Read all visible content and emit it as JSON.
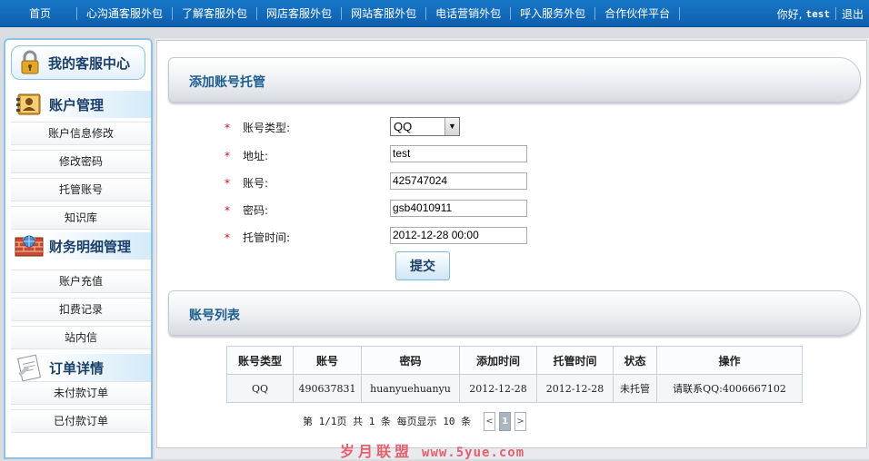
{
  "topnav": {
    "items": [
      "首页",
      "心沟通客服外包",
      "了解客服外包",
      "网店客服外包",
      "网站客服外包",
      "电话营销外包",
      "呼入服务外包",
      "合作伙伴平台"
    ],
    "greeting": "你好,",
    "username": "test",
    "logout": "退出"
  },
  "sidebar": {
    "center_title": "我的客服中心",
    "groups": [
      {
        "title": "账户管理",
        "icon": "address-book-icon",
        "items": [
          "账户信息修改",
          "修改密码",
          "托管账号",
          "知识库"
        ]
      },
      {
        "title": "财务明细管理",
        "icon": "firewall-icon",
        "items": [
          "账户充值",
          "扣费记录",
          "站内信"
        ]
      },
      {
        "title": "订单详情",
        "icon": "document-icon",
        "items": [
          "未付款订单",
          "已付款订单"
        ]
      }
    ]
  },
  "form": {
    "section_title": "添加账号托管",
    "required_mark": "*",
    "fields": {
      "type_label": "账号类型:",
      "type_value": "QQ",
      "address_label": "地址:",
      "address_value": "test",
      "account_label": "账号:",
      "account_value": "425747024",
      "password_label": "密码:",
      "password_value": "gsb4010911",
      "time_label": "托管时间:",
      "time_value": "2012-12-28 00:00"
    },
    "submit_label": "提交"
  },
  "list": {
    "section_title": "账号列表",
    "headers": [
      "账号类型",
      "账号",
      "密码",
      "添加时间",
      "托管时间",
      "状态",
      "操作"
    ],
    "rows": [
      [
        "QQ",
        "490637831",
        "huanyuehuanyu",
        "2012-12-28",
        "2012-12-28",
        "未托管",
        "请联系QQ:4006667102"
      ]
    ],
    "pager": {
      "info": "第 1/1页 共 1 条 每页显示 10 条",
      "prev": "<",
      "current": "1",
      "next": ">"
    }
  },
  "watermark": {
    "text": "岁月联盟",
    "url": "www.5yue.com"
  }
}
